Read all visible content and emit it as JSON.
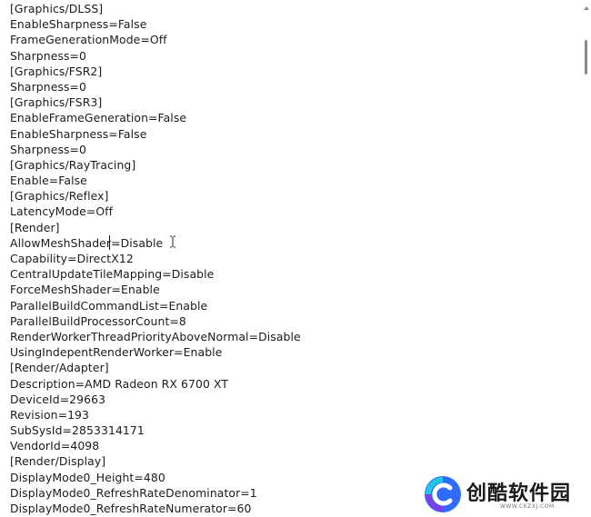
{
  "editor": {
    "lines": [
      "[Graphics/DLSS]",
      "EnableSharpness=False",
      "FrameGenerationMode=Off",
      "Sharpness=0",
      "[Graphics/FSR2]",
      "Sharpness=0",
      "[Graphics/FSR3]",
      "EnableFrameGeneration=False",
      "EnableSharpness=False",
      "Sharpness=0",
      "[Graphics/RayTracing]",
      "Enable=False",
      "[Graphics/Reflex]",
      "LatencyMode=Off",
      "[Render]",
      "AllowMeshShader=Disable",
      "Capability=DirectX12",
      "CentralUpdateTileMapping=Disable",
      "ForceMeshShader=Enable",
      "ParallelBuildCommandList=Enable",
      "ParallelBuildProcessorCount=8",
      "RenderWorkerThreadPriorityAboveNormal=Disable",
      "UsingIndepentRenderWorker=Enable",
      "[Render/Adapter]",
      "Description=AMD Radeon RX 6700 XT",
      "DeviceId=29663",
      "Revision=193",
      "SubSysId=2853314171",
      "VendorId=4098",
      "[Render/Display]",
      "DisplayMode0_Height=480",
      "DisplayMode0_RefreshRateDenominator=1",
      "DisplayMode0_RefreshRateNumerator=60"
    ]
  },
  "watermark": {
    "name": "创酷软件园",
    "url": "WWW.CKZXJ.COM"
  },
  "colors": {
    "text": "#1b1b1b",
    "background": "#ffffff",
    "scrollbar": "#8a8a8a",
    "logo_blue": "#2f6bff",
    "logo_cyan": "#22c7e6",
    "logo_purple": "#7b3fe4"
  }
}
